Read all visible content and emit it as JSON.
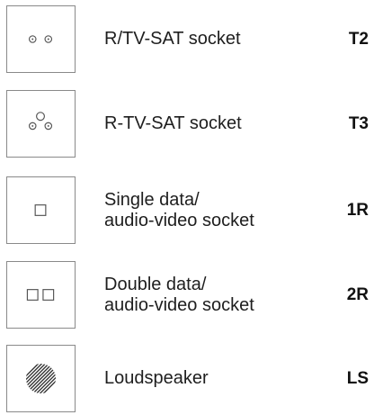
{
  "items": [
    {
      "icon": "two-dot-socket-icon",
      "lines": [
        "R/TV-SAT socket"
      ],
      "code": "T2"
    },
    {
      "icon": "three-dot-socket-icon",
      "lines": [
        "R-TV-SAT socket"
      ],
      "code": "T3"
    },
    {
      "icon": "single-square-socket-icon",
      "lines": [
        "Single data/",
        "audio-video socket"
      ],
      "code": "1R"
    },
    {
      "icon": "double-square-socket-icon",
      "lines": [
        "Double data/",
        "audio-video socket"
      ],
      "code": "2R"
    },
    {
      "icon": "loudspeaker-grille-icon",
      "lines": [
        "Loudspeaker"
      ],
      "code": "LS"
    }
  ]
}
